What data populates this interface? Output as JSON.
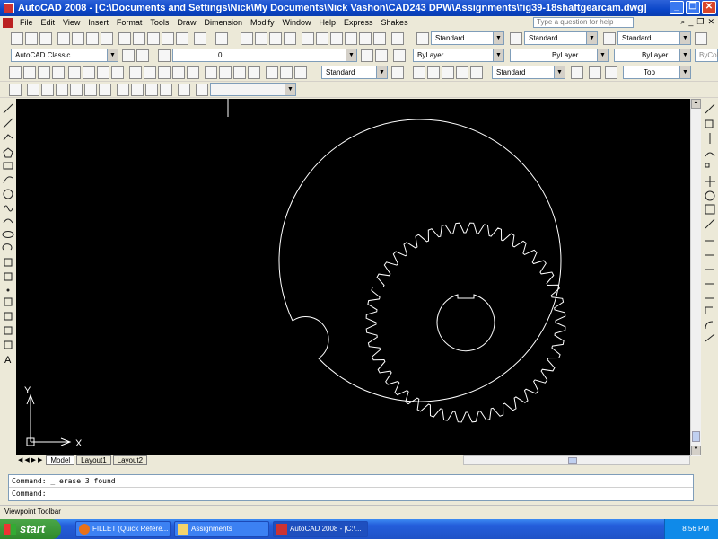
{
  "window": {
    "title": "AutoCAD 2008 - [C:\\Documents and Settings\\Nick\\My Documents\\Nick Vashon\\CAD243 DPW\\Assignments\\fig39-18shaftgearcam.dwg]",
    "buttons": [
      "_",
      "❐",
      "✕"
    ]
  },
  "menubar": {
    "items": [
      "File",
      "Edit",
      "View",
      "Insert",
      "Format",
      "Tools",
      "Draw",
      "Dimension",
      "Modify",
      "Window",
      "Help",
      "Express",
      "Shakes"
    ],
    "help_placeholder": "Type a question for help"
  },
  "toolbars": {
    "text_style": "Standard",
    "dim_style": "Standard",
    "table_style": "Standard",
    "workspace": "AutoCAD Classic",
    "layer": "0",
    "color": "ByLayer",
    "linetype": "ByLayer",
    "lineweight": "ByLayer",
    "plot_style": "ByColor",
    "dim_style_2": "Standard",
    "mleader_style": "Standard",
    "view": "Top"
  },
  "drawing": {
    "ucs_x": "X",
    "ucs_y": "Y",
    "gear_teeth": 44
  },
  "layout_tabs": [
    "Model",
    "Layout1",
    "Layout2"
  ],
  "command": {
    "history": "Command:  _.erase 3 found",
    "prompt": "Command:"
  },
  "status": {
    "text": "Viewpoint Toolbar"
  },
  "taskbar": {
    "start": "start",
    "tasks": [
      "FILLET (Quick Refere...",
      "Assignments",
      "AutoCAD 2008 - [C:\\..."
    ],
    "clock": "8:56 PM"
  },
  "colors": {
    "titlebar": "#0b46c8",
    "canvas": "#000000",
    "taskbar": "#245edb",
    "start": "#2f8a2c"
  }
}
